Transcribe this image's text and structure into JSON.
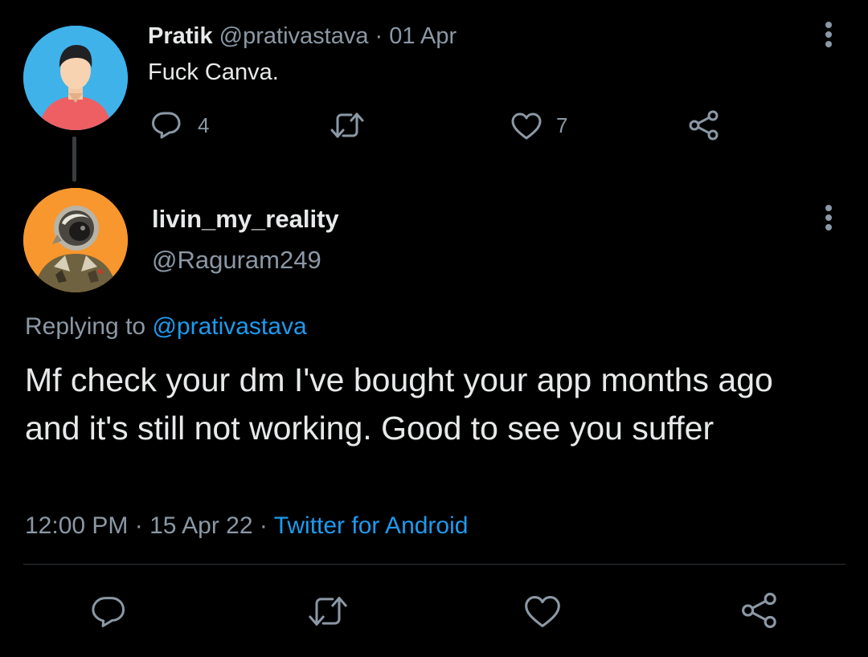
{
  "parent_tweet": {
    "name": "Pratik",
    "handle": "@prativastava",
    "separator": "·",
    "date": "01 Apr",
    "text": "Fuck Canva.",
    "reply_count": "4",
    "like_count": "7",
    "icons": [
      "reply-icon",
      "retweet-icon",
      "like-icon",
      "share-icon",
      "more-options-icon"
    ]
  },
  "reply_tweet": {
    "name": "livin_my_reality",
    "handle": "@Raguram249",
    "replying_label": "Replying to",
    "replying_handle": "@prativastava",
    "text": "Mf check your dm I've bought your app months ago and it's still not working. Good to see you suffer",
    "time": "12:00 PM",
    "date": "15 Apr 22",
    "separator": "·",
    "source": "Twitter for Android",
    "icons": [
      "reply-icon",
      "retweet-icon",
      "like-icon",
      "share-icon",
      "more-options-icon"
    ]
  },
  "colors": {
    "background": "#000000",
    "text_primary": "#e7e9ea",
    "text_secondary": "#8b98a5",
    "link": "#1d9bf0",
    "divider": "#2f3336",
    "parent_avatar_bg": "#3fb2ea",
    "reply_avatar_bg": "#f7972e"
  }
}
